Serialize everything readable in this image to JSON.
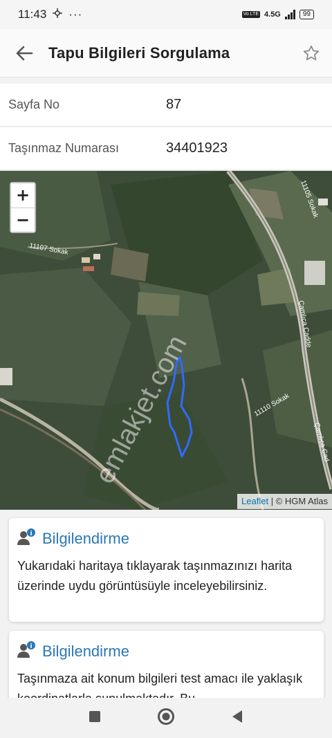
{
  "status": {
    "time": "11:43",
    "network": "4.5G",
    "battery": "99",
    "volte": "Vo LTE"
  },
  "appbar": {
    "title": "Tapu Bilgileri Sorgulama"
  },
  "fields": [
    {
      "label": "Sayfa No",
      "value": "87"
    },
    {
      "label": "Taşınmaz Numarası",
      "value": "34401923"
    }
  ],
  "map": {
    "zoom_in": "+",
    "zoom_out": "−",
    "attribution_link": "Leaflet",
    "attribution_sep": " | © ",
    "attribution_source": "HGM Atlas",
    "watermark": "emlakjet.com",
    "street_labels": [
      "11107 Sokak",
      "11105 Sokak",
      "Çamlıca Cadde",
      "11110 Sokak",
      "Çamlıca Cad"
    ],
    "parcel_color": "#2f6bff"
  },
  "cards": [
    {
      "title": "Bilgilendirme",
      "text": "Yukarıdaki haritaya tıklayarak taşınmazınızı harita üzerinde uydu görüntüsüyle inceleyebilirsiniz."
    },
    {
      "title": "Bilgilendirme",
      "text": "Taşınmaza ait konum bilgileri test amacı ile yaklaşık koordinatlarla sunulmaktadır. Bu"
    }
  ],
  "colors": {
    "accent": "#2a78b6",
    "info_badge": "#2a78b6"
  }
}
